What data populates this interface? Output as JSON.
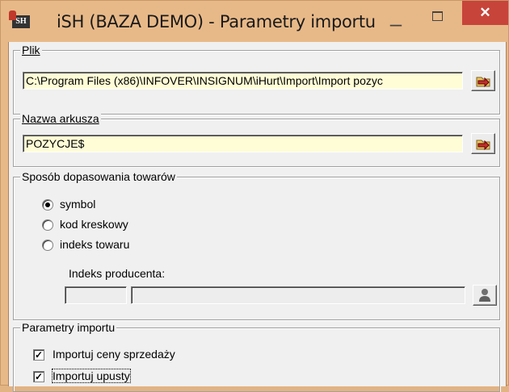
{
  "window": {
    "title": "iSH (BAZA DEMO) - Parametry importu",
    "app_icon_text": "SH",
    "minimize_glyph": "–",
    "close_glyph": "✕"
  },
  "plik": {
    "legend": "Plik",
    "value": "C:\\Program Files (x86)\\INFOVER\\INSIGNUM\\iHurt\\Import\\Import pozyc"
  },
  "arkusz": {
    "legend": "Nazwa arkusza",
    "value": "POZYCJE$"
  },
  "dopasowanie": {
    "legend": "Sposób dopasowania towarów",
    "options": [
      "symbol",
      "kod kreskowy",
      "indeks towaru"
    ],
    "selected": "symbol",
    "producer_label": "Indeks producenta:"
  },
  "parametry": {
    "legend": "Parametry importu",
    "checks": [
      {
        "label": "Importuj ceny sprzedaży",
        "checked": true
      },
      {
        "label": "Importuj upusty",
        "checked": true
      }
    ]
  }
}
